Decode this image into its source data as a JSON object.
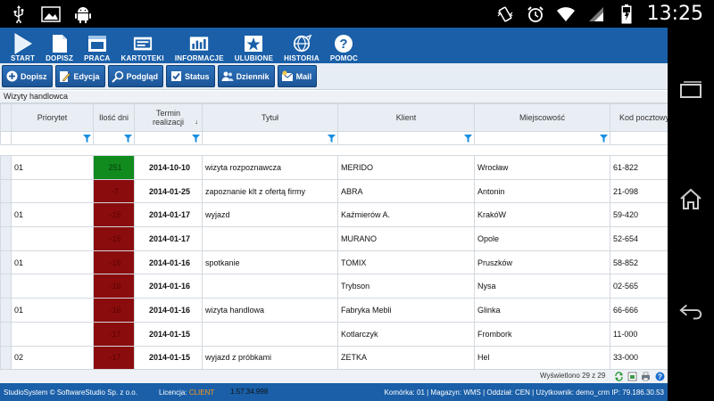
{
  "status_bar": {
    "time": "13:25",
    "icons": [
      "usb-icon",
      "image-icon",
      "android-icon",
      "vibrate-icon",
      "alarm-icon",
      "wifi-icon",
      "signal-icon",
      "battery-icon"
    ]
  },
  "main_menu": [
    {
      "label": "START",
      "icon": "play-icon"
    },
    {
      "label": "DOPISZ",
      "icon": "document-icon"
    },
    {
      "label": "PRACA",
      "icon": "window-icon"
    },
    {
      "label": "KARTOTEKI",
      "icon": "card-icon"
    },
    {
      "label": "INFORMACJE",
      "icon": "bar-chart-icon"
    },
    {
      "label": "ULUBIONE",
      "icon": "star-icon"
    },
    {
      "label": "HISTORIA",
      "icon": "globe-icon"
    },
    {
      "label": "POMOC",
      "icon": "help-icon"
    }
  ],
  "toolbar": {
    "buttons": [
      {
        "label": "Dopisz",
        "icon": "add-icon"
      },
      {
        "label": "Edycja",
        "icon": "edit-icon"
      },
      {
        "label": "Podgląd",
        "icon": "magnifier-icon"
      },
      {
        "label": "Status",
        "icon": "checkbox-icon"
      },
      {
        "label": "Dziennik",
        "icon": "people-icon"
      },
      {
        "label": "Mail",
        "icon": "mail-icon"
      }
    ]
  },
  "section_title": "Wizyty handlowca",
  "grid": {
    "columns": [
      "Priorytet",
      "Ilość dni",
      "Termin realizacji",
      "Tytuł",
      "Klient",
      "Miejscowość",
      "Kod pocztowy"
    ],
    "rows": [
      {
        "priorytet": "01",
        "ilosc": "251",
        "ilosc_status": "green",
        "termin": "2014-10-10",
        "tytul": "wizyta rozpoznawcza",
        "klient": "MERIDO",
        "miejscowosc": "Wrocław",
        "kod": "61-822"
      },
      {
        "priorytet": "",
        "ilosc": "-7",
        "ilosc_status": "red",
        "termin": "2014-01-25",
        "tytul": "zapoznanie klt z ofertą firmy",
        "klient": "ABRA",
        "miejscowosc": "Antonin",
        "kod": "21-098"
      },
      {
        "priorytet": "01",
        "ilosc": "-15",
        "ilosc_status": "red",
        "termin": "2014-01-17",
        "tytul": "wyjazd",
        "klient": "Kaźmierów A.",
        "miejscowosc": "KrakóW",
        "kod": "59-420"
      },
      {
        "priorytet": "",
        "ilosc": "-15",
        "ilosc_status": "red",
        "termin": "2014-01-17",
        "tytul": "",
        "klient": "MURANO",
        "miejscowosc": "Opole",
        "kod": "52-654"
      },
      {
        "priorytet": "01",
        "ilosc": "-16",
        "ilosc_status": "red",
        "termin": "2014-01-16",
        "tytul": "spotkanie",
        "klient": "TOMIX",
        "miejscowosc": "Pruszków",
        "kod": "58-852"
      },
      {
        "priorytet": "",
        "ilosc": "-16",
        "ilosc_status": "red",
        "termin": "2014-01-16",
        "tytul": "",
        "klient": "Trybson",
        "miejscowosc": "Nysa",
        "kod": "02-565"
      },
      {
        "priorytet": "01",
        "ilosc": "-16",
        "ilosc_status": "red",
        "termin": "2014-01-16",
        "tytul": "wizyta handlowa",
        "klient": "Fabryka Mebli",
        "miejscowosc": "Glinka",
        "kod": "66-666"
      },
      {
        "priorytet": "",
        "ilosc": "-17",
        "ilosc_status": "red",
        "termin": "2014-01-15",
        "tytul": "",
        "klient": "Kotlarczyk",
        "miejscowosc": "Frombork",
        "kod": "11-000"
      },
      {
        "priorytet": "02",
        "ilosc": "-17",
        "ilosc_status": "red",
        "termin": "2014-01-15",
        "tytul": "wyjazd z próbkami",
        "klient": "ZETKA",
        "miejscowosc": "Hel",
        "kod": "33-000"
      }
    ]
  },
  "footer": {
    "row_count": "Wyświetlono 29 z 29"
  },
  "app_status": {
    "company": "StudioSystem © SoftwareStudio Sp. z o.o.",
    "license_label": "Licencja:",
    "license_value": "CLIENT",
    "version": "1.57.34.998",
    "session": "Komórka: 01 | Magazyn: WMS | Oddział: CEN | Użytkownik: demo_crm IP: 79.186.30.53"
  },
  "colors": {
    "menu_blue": "#1a5fa8",
    "overdue_red": "#8b0c0c",
    "ok_green": "#118a1e",
    "license_orange": "#ff9a1a"
  }
}
